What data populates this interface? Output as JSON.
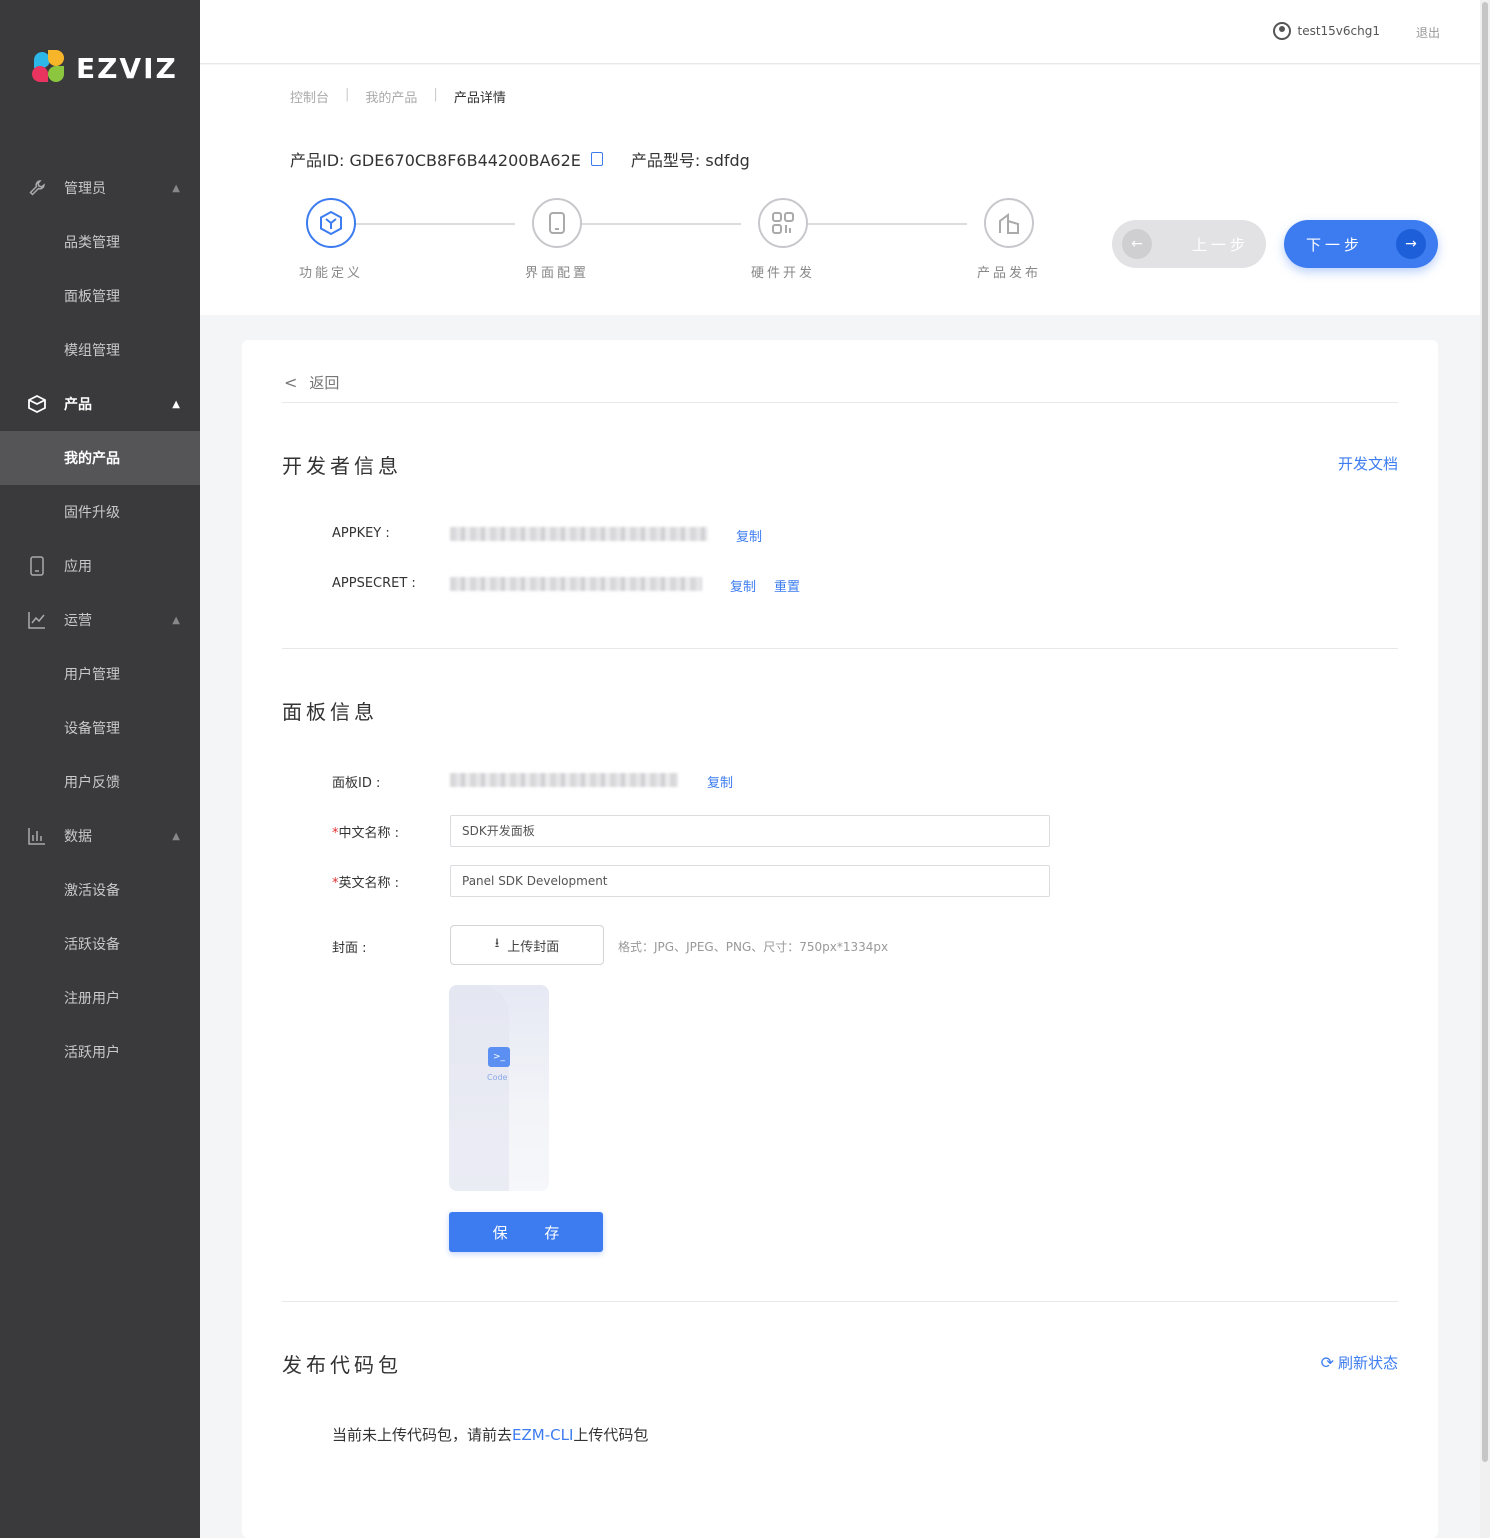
{
  "brand": {
    "name": "EZVIZ",
    "colors": {
      "accent": "#3c7cf0",
      "sidebar_bg": "#3a3a3c",
      "required": "#e03030"
    }
  },
  "sidebar": {
    "items": [
      {
        "label": "管理员",
        "icon": "wrench-icon",
        "type": "group",
        "expanded": true
      },
      {
        "label": "品类管理",
        "type": "child"
      },
      {
        "label": "面板管理",
        "type": "child"
      },
      {
        "label": "模组管理",
        "type": "child"
      },
      {
        "label": "产品",
        "icon": "box-icon",
        "type": "group",
        "expanded": true
      },
      {
        "label": "我的产品",
        "type": "child",
        "active": true
      },
      {
        "label": "固件升级",
        "type": "child"
      },
      {
        "label": "应用",
        "icon": "phone-icon",
        "type": "group"
      },
      {
        "label": "运营",
        "icon": "chart-line-icon",
        "type": "group",
        "expanded": true
      },
      {
        "label": "用户管理",
        "type": "child"
      },
      {
        "label": "设备管理",
        "type": "child"
      },
      {
        "label": "用户反馈",
        "type": "child"
      },
      {
        "label": "数据",
        "icon": "bar-chart-icon",
        "type": "group",
        "expanded": true
      },
      {
        "label": "激活设备",
        "type": "child"
      },
      {
        "label": "活跃设备",
        "type": "child"
      },
      {
        "label": "注册用户",
        "type": "child"
      },
      {
        "label": "活跃用户",
        "type": "child"
      }
    ]
  },
  "header": {
    "username": "test15v6chg1",
    "logout": "退出"
  },
  "breadcrumb": {
    "items": [
      "控制台",
      "我的产品",
      "产品详情"
    ],
    "separator": "|"
  },
  "product": {
    "id_label": "产品ID: GDE670CB8F6B44200BA62E",
    "model_label": "产品型号: sdfdg"
  },
  "steps": [
    {
      "label": "功能定义",
      "icon": "cube-icon",
      "active": true
    },
    {
      "label": "界面配置",
      "icon": "phone-icon",
      "active": false
    },
    {
      "label": "硬件开发",
      "icon": "grid-icon",
      "active": false
    },
    {
      "label": "产品发布",
      "icon": "building-icon",
      "active": false
    }
  ],
  "nav_buttons": {
    "prev": "上一步",
    "next": "下一步"
  },
  "back": "返回",
  "developer": {
    "title": "开发者信息",
    "doc_link": "开发文档",
    "appkey_label": "APPKEY :",
    "appsecret_label": "APPSECRET :",
    "copy": "复制",
    "reset": "重置"
  },
  "panel": {
    "title": "面板信息",
    "id_label": "面板ID :",
    "copy": "复制",
    "cn_name_label": "中文名称 :",
    "cn_name_value": "SDK开发面板",
    "en_name_label": "英文名称 :",
    "en_name_value": "Panel SDK Development",
    "required_mark": "*",
    "cover_label": "封面 :",
    "upload_label": "上传封面",
    "format_hint": "格式：JPG、JPEG、PNG、尺寸：750px*1334px",
    "cover_icon_text": "Code",
    "save": "保 存"
  },
  "package": {
    "title": "发布代码包",
    "refresh": "刷新状态",
    "text_before": "当前未上传代码包，请前去",
    "link": "EZM-CLI",
    "text_after": "上传代码包"
  }
}
